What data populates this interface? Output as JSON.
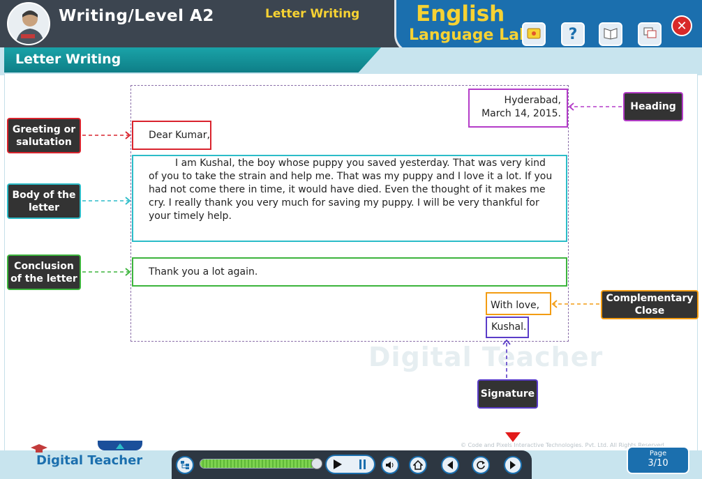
{
  "header": {
    "title": "Writing/Level A2",
    "subtitle": "Letter Writing",
    "brand_line1": "English",
    "brand_line2": "Language Lab",
    "close_symbol": "✕"
  },
  "section": {
    "title": "Letter Writing"
  },
  "letter": {
    "heading_city": "Hyderabad,",
    "heading_date": "March 14, 2015.",
    "greeting": "Dear Kumar,",
    "body": "I am Kushal, the boy whose puppy you saved yesterday. That was very kind of you to take the strain and help me. That was my puppy and I love it a lot. If you had not come there in time, it would have died. Even the thought of it makes me cry. I really thank you very much for saving my puppy. I will be very thankful for your timely help.",
    "conclusion": "Thank you a lot again.",
    "complementary_close": "With love,",
    "signature": "Kushal."
  },
  "labels": {
    "greeting": "Greeting or salutation",
    "body": "Body of the letter",
    "conclusion": "Conclusion of the letter",
    "heading": "Heading",
    "complementary_close": "Complementary Close",
    "signature": "Signature"
  },
  "colors": {
    "greeting": "#d9232d",
    "body": "#2bbcc8",
    "conclusion": "#3cb43c",
    "heading": "#b43cc8",
    "complementary_close": "#f39c12",
    "signature": "#5a3cc8"
  },
  "watermark": "Digital Teacher",
  "footer": {
    "logo": "Digital Teacher",
    "copyright": "© Code and Pixels Interactive Technologies. Pvt. Ltd. All Rights Reserved.",
    "page_label": "Page",
    "page_num": "3/10",
    "progress": 0.97
  }
}
